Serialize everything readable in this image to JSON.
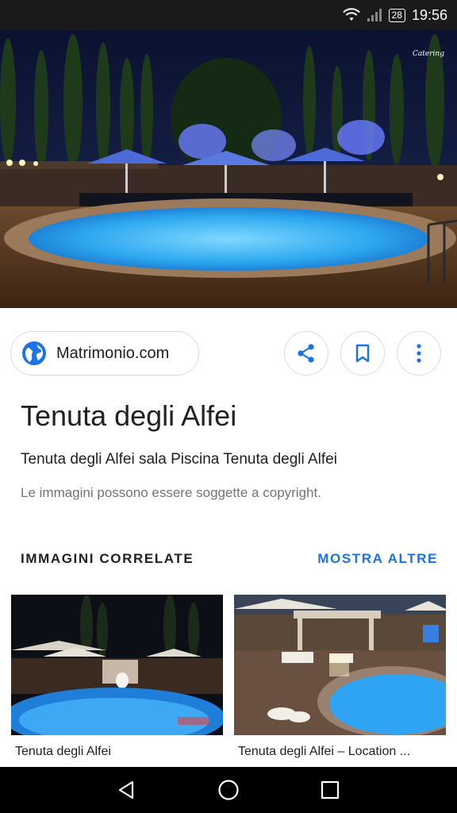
{
  "status_bar": {
    "battery": "28",
    "time": "19:56"
  },
  "source": {
    "label": "Matrimonio.com"
  },
  "title": "Tenuta degli Alfei",
  "subtitle": "Tenuta degli Alfei sala Piscina Tenuta degli Alfei",
  "copyright_notice": "Le immagini possono essere soggette a copyright.",
  "related": {
    "heading": "IMMAGINI CORRELATE",
    "more_label": "MOSTRA ALTRE",
    "items": [
      {
        "caption": "Tenuta degli Alfei"
      },
      {
        "caption": "Tenuta degli Alfei – Location ..."
      }
    ]
  },
  "colors": {
    "accent": "#1a73e8",
    "globe": "#1a73e8"
  }
}
